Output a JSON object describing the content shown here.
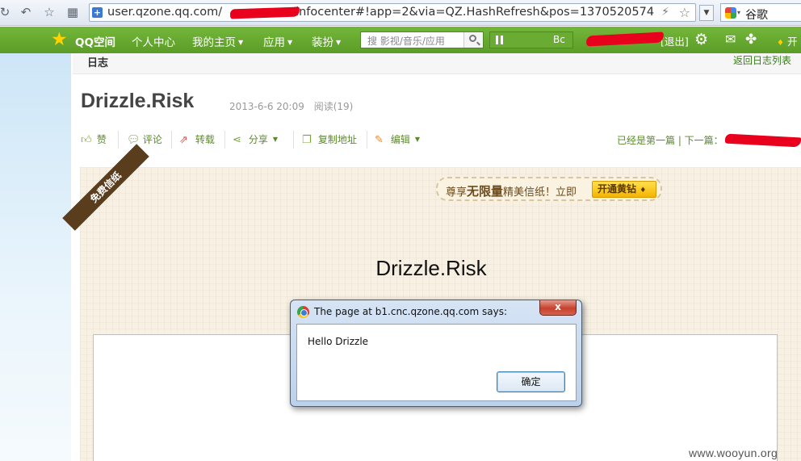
{
  "browser": {
    "url": "user.qzone.qq.com/",
    "url_rest": "/infocenter#!app=2&via=QZ.HashRefresh&pos=1370520574",
    "search_engine_label": "谷歌"
  },
  "qzone_bar": {
    "brand": "QQ空间",
    "menu": [
      {
        "label": "个人中心"
      },
      {
        "label": "我的主页"
      },
      {
        "label": "应用"
      },
      {
        "label": "装扮"
      }
    ],
    "search_placeholder": "搜 影视/音乐/应用",
    "player_text": "Bc",
    "logout": "[退出]",
    "vip_label": "开"
  },
  "section": {
    "title": "日志",
    "back_link": "返回日志列表"
  },
  "post": {
    "title": "Drizzle.Risk",
    "date": "2013-6-6 20:09",
    "reads": "阅读(19)"
  },
  "actions": {
    "like": "赞",
    "comment": "评论",
    "repost": "转载",
    "share": "分享",
    "copy_link": "复制地址",
    "edit": "编辑",
    "prev_next": "已经是第一篇 | 下一篇："
  },
  "letter": {
    "ribbon": "免费信纸",
    "promo_prefix": "尊享",
    "promo_bold": "无限量",
    "promo_suffix": "精美信纸！立即",
    "promo_button": "开通黄钻",
    "title": "Drizzle.Risk"
  },
  "dialog": {
    "title": "The page at b1.cnc.qzone.qq.com says:",
    "message": "Hello Drizzle",
    "ok_button": "确定",
    "close_glyph": "x"
  },
  "watermark": "www.wooyun.org",
  "colors": {
    "qzone_green": "#66a830",
    "link_green": "#5b8a2c",
    "paper": "#f8f1e3",
    "redaction": "#e8001c"
  }
}
